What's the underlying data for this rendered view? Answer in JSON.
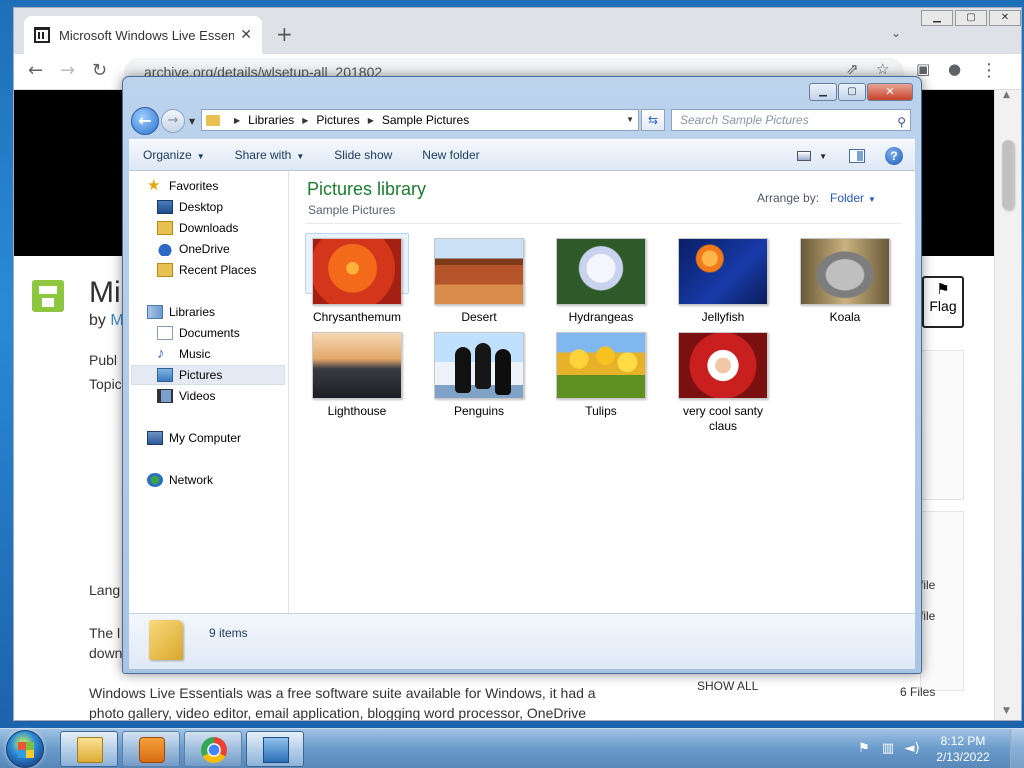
{
  "browser": {
    "tab_title": "Microsoft Windows Live Essentials",
    "url": "archive.org/details/wlsetup-all_201802",
    "page_title_partial": "Mi",
    "by_prefix": "by ",
    "by_link_partial": "M",
    "publ_partial": "Publ",
    "topic_partial": "Topic",
    "lang_partial": "Lang",
    "the_partial": "The l",
    "down_partial": "down",
    "description_line1": "Windows Live Essentials was a free software suite available for Windows, it had a",
    "description_line2": "photo gallery, video editor, email application, blogging word processor, OneDrive",
    "flag_label": "Flag",
    "file_label_1": "file",
    "file_label_2": "file",
    "show_all": "SHOW ALL",
    "files_count": "6 Files"
  },
  "explorer": {
    "address": {
      "crumbs": [
        "Libraries",
        "Pictures",
        "Sample Pictures"
      ]
    },
    "search_placeholder": "Search Sample Pictures",
    "commands": {
      "organize": "Organize",
      "share_with": "Share with",
      "slide_show": "Slide show",
      "new_folder": "New folder"
    },
    "nav": {
      "favorites": "Favorites",
      "desktop": "Desktop",
      "downloads": "Downloads",
      "onedrive": "OneDrive",
      "recent_places": "Recent Places",
      "libraries": "Libraries",
      "documents": "Documents",
      "music": "Music",
      "pictures": "Pictures",
      "videos": "Videos",
      "my_computer": "My Computer",
      "network": "Network"
    },
    "library_title": "Pictures library",
    "library_subtitle": "Sample Pictures",
    "arrange_by_label": "Arrange by:",
    "arrange_by_value": "Folder",
    "items": [
      {
        "name": "Chrysanthemum"
      },
      {
        "name": "Desert"
      },
      {
        "name": "Hydrangeas"
      },
      {
        "name": "Jellyfish"
      },
      {
        "name": "Koala"
      },
      {
        "name": "Lighthouse"
      },
      {
        "name": "Penguins"
      },
      {
        "name": "Tulips"
      },
      {
        "name": "very cool santy claus"
      }
    ],
    "status": "9 items"
  },
  "taskbar": {
    "time": "8:12 PM",
    "date": "2/13/2022"
  },
  "colors": {
    "library_title": "#1e7b31",
    "link_blue": "#2258b6",
    "taskbar": "#6a9bcb"
  }
}
